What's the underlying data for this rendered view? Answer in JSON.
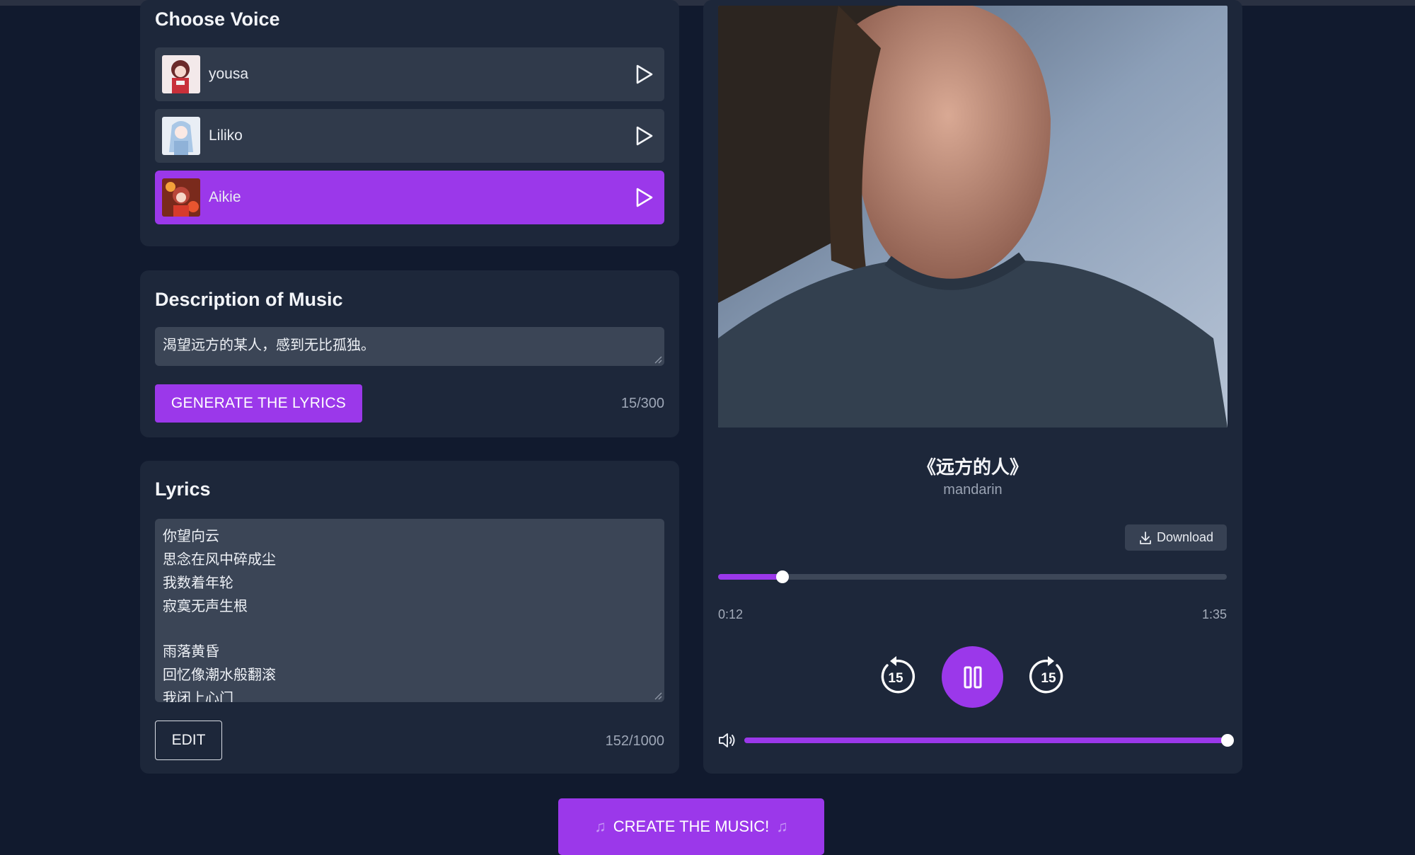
{
  "voice_panel": {
    "title": "Choose Voice",
    "voices": [
      {
        "name": "yousa",
        "selected": false
      },
      {
        "name": "Liliko",
        "selected": false
      },
      {
        "name": "Aikie",
        "selected": true
      }
    ]
  },
  "description_panel": {
    "title": "Description of Music",
    "value": "渴望远方的某人，感到无比孤独。",
    "generate_label": "GENERATE THE LYRICS",
    "counter": "15/300"
  },
  "lyrics_panel": {
    "title": "Lyrics",
    "lines": [
      "你望向云",
      "思念在风中碎成尘",
      "我数着年轮",
      "寂寞无声生根",
      "",
      "雨落黄昏",
      "回忆像潮水般翻滚",
      "我闭上心门"
    ],
    "edit_label": "EDIT",
    "counter": "152/1000"
  },
  "player": {
    "title": "《远方的人》",
    "subtitle": "mandarin",
    "download_label": "Download",
    "current_time": "0:12",
    "duration": "1:35",
    "progress_fraction": 0.126,
    "volume_fraction": 1.0,
    "skip_back_label": "15",
    "skip_forward_label": "15"
  },
  "create_button": {
    "label": "CREATE THE MUSIC!"
  },
  "colors": {
    "accent": "#9b38ea",
    "background": "#111a2e",
    "panel": "#1d273a"
  }
}
